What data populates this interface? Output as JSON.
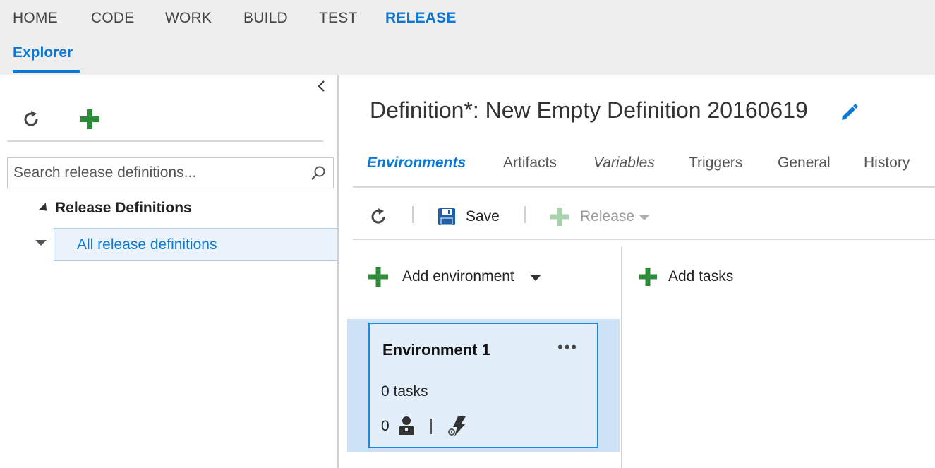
{
  "nav": {
    "items": [
      {
        "label": "HOME"
      },
      {
        "label": "CODE"
      },
      {
        "label": "WORK"
      },
      {
        "label": "BUILD"
      },
      {
        "label": "TEST"
      },
      {
        "label": "RELEASE",
        "active": true
      }
    ],
    "sub": {
      "label": "Explorer"
    }
  },
  "left": {
    "collapse_icon": "chevron-left-icon",
    "toolbar": {
      "refresh_icon": "refresh-icon",
      "add_icon": "plus-icon"
    },
    "search": {
      "placeholder": "Search release definitions..."
    },
    "tree": {
      "root_label": "Release Definitions",
      "items": [
        {
          "label": "All release definitions",
          "selected": true
        }
      ]
    }
  },
  "definition": {
    "title": "Definition*: New Empty Definition 20160619",
    "edit_icon": "pencil-icon"
  },
  "tabs": [
    {
      "label": "Environments",
      "active": true
    },
    {
      "label": "Artifacts"
    },
    {
      "label": "Variables"
    },
    {
      "label": "Triggers"
    },
    {
      "label": "General"
    },
    {
      "label": "History"
    }
  ],
  "toolbar": {
    "refresh_icon": "refresh-icon",
    "save_label": "Save",
    "save_icon": "floppy-disk-icon",
    "release_label": "Release",
    "release_icon": "plus-icon",
    "release_enabled": false
  },
  "environments": {
    "add_label": "Add environment",
    "add_tasks_label": "Add tasks",
    "cards": [
      {
        "name": "Environment 1",
        "more": "•••",
        "tasks": "0 tasks",
        "approvers": "0"
      }
    ]
  },
  "colors": {
    "accent": "#0a78d4",
    "green_plus": "#2e8b3a",
    "env_card_bg": "#e2effa",
    "env_card_border": "#1a8ad8"
  }
}
